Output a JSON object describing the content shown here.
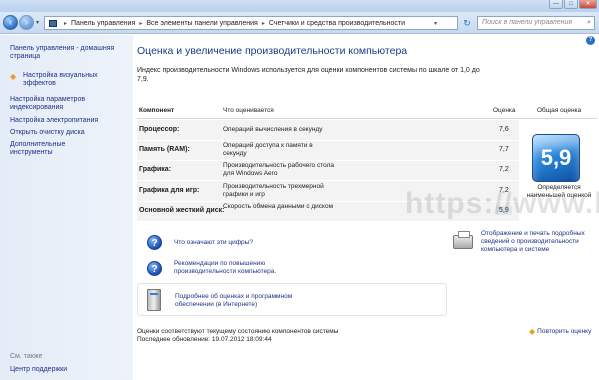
{
  "window": {
    "buttons": [
      "—",
      "□",
      "✕"
    ]
  },
  "nav": {
    "back_icon": "back-arrow-icon",
    "forward_icon": "forward-arrow-icon",
    "breadcrumb": [
      "Панель управления",
      "Все элементы панели управления",
      "Счетчики и средства производительности"
    ],
    "search_placeholder": "Поиск в панели управления"
  },
  "sidebar": {
    "home": "Панель управления - домашняя страница",
    "items": [
      "Настройка визуальных эффектов",
      "Настройка параметров индексирования",
      "Настройка электропитания",
      "Открыть очистку диска",
      "Дополнительные инструменты"
    ],
    "see_also": "См. также",
    "support": "Центр поддержки"
  },
  "main": {
    "title": "Оценка и увеличение производительности компьютера",
    "intro": "Индекс производительности Windows используется для оценки компонентов системы по шкале от 1,0 до 7,9.",
    "table": {
      "headers": [
        "Компонент",
        "Что оценивается",
        "Оценка",
        "Общая оценка"
      ],
      "rows": [
        {
          "component": "Процессор:",
          "description": "Операций вычисления в секунду",
          "score": "7,6"
        },
        {
          "component": "Память (RAM):",
          "description": "Операций доступа к памяти в секунду",
          "score": "7,7"
        },
        {
          "component": "Графика:",
          "description": "Производительность рабочего стола для Windows Aero",
          "score": "7,2"
        },
        {
          "component": "Графика для игр:",
          "description": "Производительность трехмерной графики и игр",
          "score": "7,2"
        },
        {
          "component": "Основной жесткий диск:",
          "description": "Скорость обмена данными с диском",
          "score": "5,9"
        }
      ],
      "overall": "5,9",
      "overall_note": "Определяется наименьшей оценкой"
    },
    "links": {
      "what_mean": "Что означают эти цифры?",
      "tips": "Рекомендации по повышению производительности компьютера.",
      "print": "Отображение и печать подробных сведений о производительности компьютера и системе",
      "online": "Подробнее об оценках и программном обеспечении (в Интернете)"
    },
    "footer": {
      "status": "Оценки соответствуют текущему состоянию компонентов системы",
      "updated": "Последнее обновление: 19.07.2012 18:09:44",
      "rerun": "Повторить оценку"
    },
    "watermark": "https://www.km.ua"
  }
}
